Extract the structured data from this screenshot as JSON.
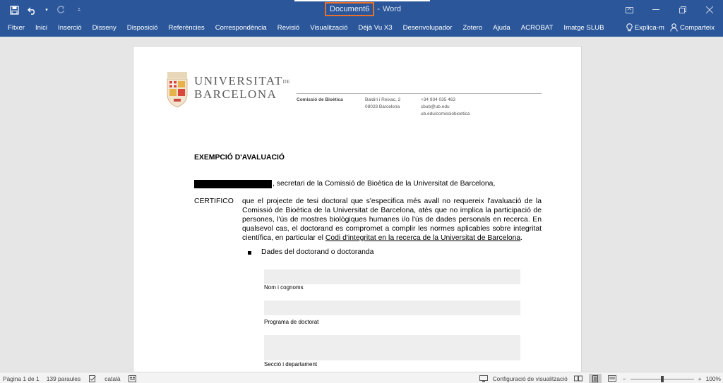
{
  "titlebar": {
    "document_name": "Document6",
    "separator": "-",
    "app_name": "Word",
    "icons": [
      "save-icon",
      "undo-icon",
      "redo-icon",
      "customize-qat-icon"
    ],
    "window_icons": [
      "ribbon-display-icon",
      "minimize-icon",
      "restore-icon",
      "close-icon"
    ]
  },
  "ribbon": {
    "tabs": [
      "Fitxer",
      "Inici",
      "Inserció",
      "Disseny",
      "Disposició",
      "Referències",
      "Correspondència",
      "Revisió",
      "Visualització",
      "Déjà Vu X3",
      "Desenvolupador",
      "Zotero",
      "Ajuda",
      "ACROBAT",
      "Imatge SLUB"
    ],
    "tell_me": "Explica-m",
    "share": "Comparteix"
  },
  "document": {
    "university_line1": "UNIVERSITAT",
    "university_de": "DE",
    "university_line2": "BARCELONA",
    "header": {
      "committee": "Comissió de Bioètica",
      "address_line1": "Baldiri i Reixac, 2",
      "address_line2": "08028 Barcelona",
      "phone": "+34 934 035 463",
      "email": "cbub@ub.edu",
      "web": "ub.edu/comissiobioetica"
    },
    "heading": "EXEMPCIÓ D'AVALUACIÓ",
    "line1": ", secretari de la Comissió de Bioètica de la Universitat de Barcelona,",
    "certifico_label": "CERTIFICO",
    "certifico_text": "que el projecte de tesi doctoral que s'especifica més avall no requereix l'avaluació de la Comissió de Bioètica de la Universitat de Barcelona, atès que no implica la participació de persones, l'ús de mostres biològiques humanes i/o l'ús de dades personals en recerca. En qualsevol cas, el doctorand es compromet a complir les normes aplicables sobre integritat científica, en particular el ",
    "certifico_link": "Codi d'integritat en la recerca de la Universitat de Barcelona",
    "certifico_end": ".",
    "bullet": "Dades del doctorand o doctoranda",
    "fields": [
      "Nom i cognoms",
      "Programa de doctorat",
      "Secció i departament"
    ]
  },
  "statusbar": {
    "page": "Pàgina 1 de 1",
    "words": "139 paraules",
    "language": "català",
    "display_settings": "Configuració de visualització",
    "zoom_minus": "−",
    "zoom_plus": "+",
    "zoom": "100%",
    "zoom_level": 100
  }
}
